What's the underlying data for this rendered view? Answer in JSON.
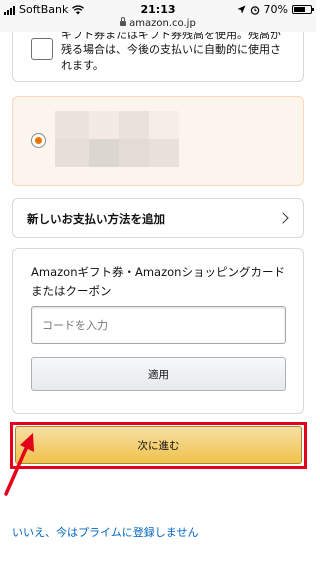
{
  "status_bar": {
    "carrier": "SoftBank",
    "time": "21:13",
    "battery_text": "70%",
    "battery_level": 0.7
  },
  "url_bar": {
    "domain": "amazon.co.jp"
  },
  "gift_balance": {
    "text_line1": "ギフト券またはギフト券残高を使用。残高が",
    "text_line2": "残る場合は、今後の支払いに自動的に使用さ",
    "text_line3": "れます。",
    "checked": false
  },
  "payment_method": {
    "selected": true,
    "accent_color": "#e77600"
  },
  "add_payment": {
    "label": "新しいお支払い方法を追加"
  },
  "coupon": {
    "title": "Amazonギフト券・Amazonショッピングカード またはクーポン",
    "input_placeholder": "コードを入力",
    "input_value": "",
    "apply_label": "適用"
  },
  "next_button": {
    "label": "次に進む",
    "highlight_color": "#e4001b"
  },
  "prime_link": {
    "label": "いいえ、今はプライムに登録しません"
  }
}
